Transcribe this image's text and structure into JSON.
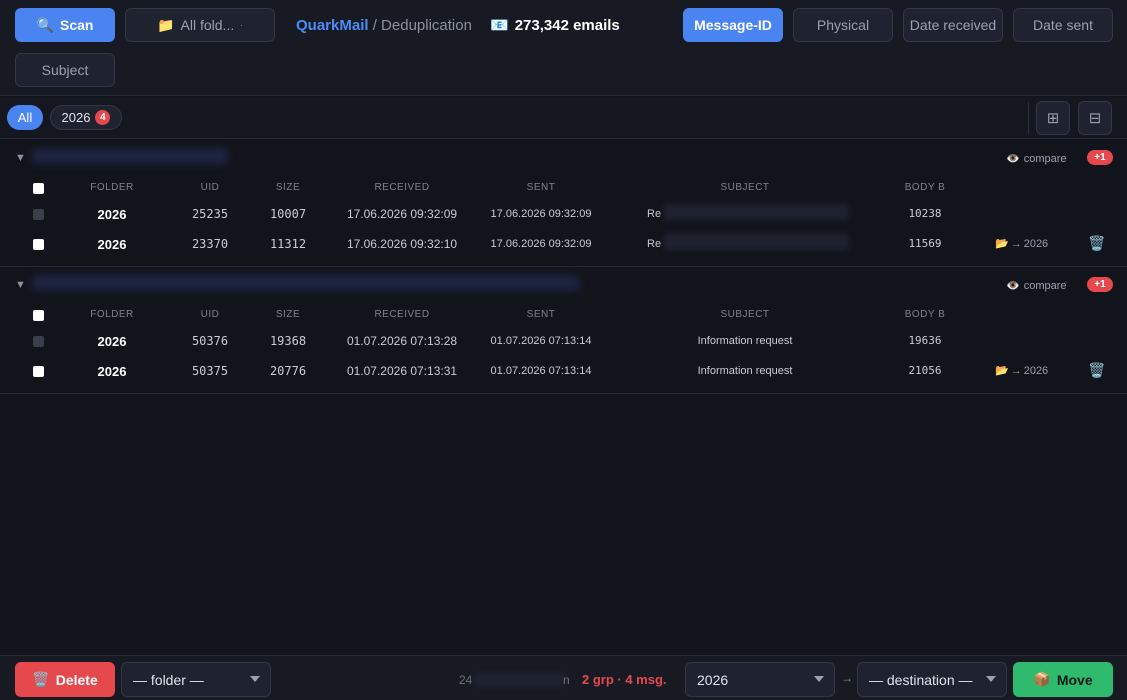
{
  "toolbar": {
    "scan_label": "Scan",
    "folder_label": "All fold...",
    "app_name": "QuarkMail",
    "separator": "/",
    "page_name": "Deduplication",
    "email_count": "273,342 emails",
    "modes": [
      "Message-ID",
      "Physical",
      "Date received",
      "Date sent",
      "Subject"
    ],
    "active_mode": "Message-ID"
  },
  "filters": {
    "all_label": "All",
    "year_label": "2026",
    "year_count": "4"
  },
  "columns": [
    "FOLDER",
    "UID",
    "SIZE",
    "RECEIVED",
    "SENT",
    "SUBJECT",
    "BODY B"
  ],
  "groups": [
    {
      "compare_label": "compare",
      "extra_badge": "+1",
      "rows": [
        {
          "folder": "2026",
          "uid": "25235",
          "size": "10007",
          "received": "17.06.2026 09:32:09",
          "sent": "17.06.2026 09:32:09",
          "subject": "Re",
          "body": "10238",
          "move_target": ""
        },
        {
          "folder": "2026",
          "uid": "23370",
          "size": "11312",
          "received": "17.06.2026 09:32:10",
          "sent": "17.06.2026 09:32:09",
          "subject": "Re",
          "body": "11569",
          "move_target": "2026"
        }
      ]
    },
    {
      "compare_label": "compare",
      "extra_badge": "+1",
      "rows": [
        {
          "folder": "2026",
          "uid": "50376",
          "size": "19368",
          "received": "01.07.2026 07:13:28",
          "sent": "01.07.2026 07:13:14",
          "subject": "Information request",
          "body": "19636",
          "move_target": ""
        },
        {
          "folder": "2026",
          "uid": "50375",
          "size": "20776",
          "received": "01.07.2026 07:13:31",
          "sent": "01.07.2026 07:13:14",
          "subject": "Information request",
          "body": "21056",
          "move_target": "2026"
        }
      ]
    }
  ],
  "bottom": {
    "delete_label": "Delete",
    "folder_select": "— folder —",
    "stat_prefix": "24",
    "stat_suffix": "n",
    "summary": "2 grp · 4 msg.",
    "year_select": "2026",
    "arrow": "→",
    "destination_select": "— destination —",
    "move_label": "Move"
  },
  "colors": {
    "accent": "#4a84f0",
    "danger": "#e5484d",
    "success": "#2fba6e",
    "background": "#12141b"
  }
}
